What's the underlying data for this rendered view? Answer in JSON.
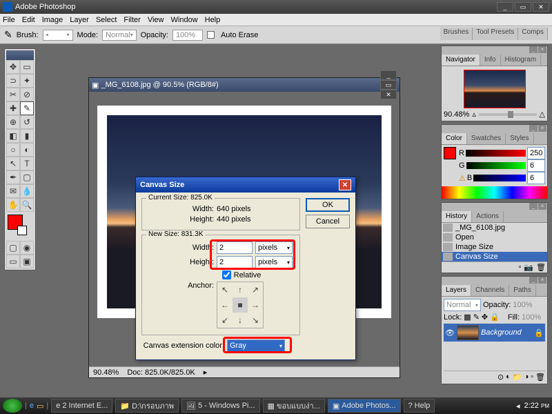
{
  "app": {
    "title": "Adobe Photoshop"
  },
  "menu": {
    "file": "File",
    "edit": "Edit",
    "image": "Image",
    "layer": "Layer",
    "select": "Select",
    "filter": "Filter",
    "view": "View",
    "window": "Window",
    "help": "Help"
  },
  "opt": {
    "brush": "Brush:",
    "mode": "Mode:",
    "mode_val": "Normal",
    "opacity": "Opacity:",
    "opacity_val": "100%",
    "autoerase": "Auto Erase"
  },
  "palettebar": {
    "brushes": "Brushes",
    "toolpresets": "Tool Presets",
    "comps": "Comps"
  },
  "nav": {
    "tab1": "Navigator",
    "tab2": "Info",
    "tab3": "Histogram",
    "zoom": "90.48%"
  },
  "color": {
    "tab1": "Color",
    "tab2": "Swatches",
    "tab3": "Styles",
    "r": "R",
    "g": "G",
    "b": "B",
    "rv": "250",
    "gv": "6",
    "bv": "6"
  },
  "history": {
    "tab1": "History",
    "tab2": "Actions",
    "file": "_MG_6108.jpg",
    "open": "Open",
    "imgsize": "Image Size",
    "canvassize": "Canvas Size"
  },
  "layers": {
    "tab1": "Layers",
    "tab2": "Channels",
    "tab3": "Paths",
    "mode": "Normal",
    "opacity": "Opacity:",
    "opv": "100%",
    "lock": "Lock:",
    "fill": "Fill:",
    "fillv": "100%",
    "bg": "Background"
  },
  "doc": {
    "title": "_MG_6108.jpg @ 90.5% (RGB/8#)",
    "zoom": "90.48%",
    "size": "Doc: 825.0K/825.0K"
  },
  "dlg": {
    "title": "Canvas Size",
    "cur": "Current Size: 825.0K",
    "curw": "Width:",
    "curw_v": "640 pixels",
    "curh": "Height:",
    "curh_v": "440 pixels",
    "new": "New Size: 831.3K",
    "w": "Width:",
    "w_v": "2",
    "w_u": "pixels",
    "h": "Height:",
    "h_v": "2",
    "h_u": "pixels",
    "rel": "Relative",
    "anchor": "Anchor:",
    "ext": "Canvas extension color:",
    "ext_v": "Gray",
    "ok": "OK",
    "cancel": "Cancel"
  },
  "taskbar": {
    "ie": "2 Internet E...",
    "ex": "D:\\กรอบภาพ",
    "pic": "5 - Windows Pi...",
    "th": "ขอบแบบง่า...",
    "ps": "Adobe Photos...",
    "help": "Help",
    "time": "2:22",
    "ampm": "PM"
  }
}
